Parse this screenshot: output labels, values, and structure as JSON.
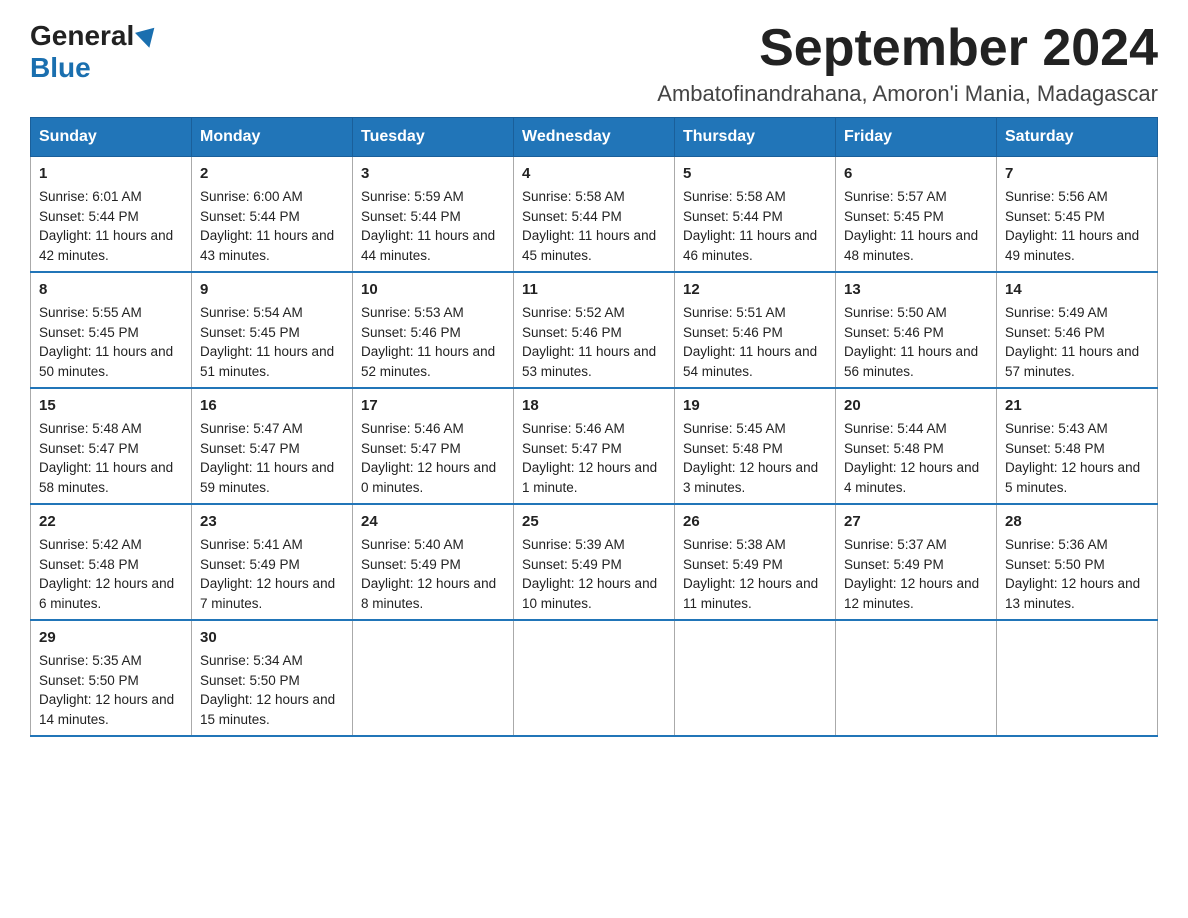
{
  "logo": {
    "general": "General",
    "blue": "Blue"
  },
  "title": "September 2024",
  "location": "Ambatofinandrahana, Amoron'i Mania, Madagascar",
  "weekdays": [
    "Sunday",
    "Monday",
    "Tuesday",
    "Wednesday",
    "Thursday",
    "Friday",
    "Saturday"
  ],
  "weeks": [
    [
      {
        "day": "1",
        "sunrise": "6:01 AM",
        "sunset": "5:44 PM",
        "daylight": "11 hours and 42 minutes."
      },
      {
        "day": "2",
        "sunrise": "6:00 AM",
        "sunset": "5:44 PM",
        "daylight": "11 hours and 43 minutes."
      },
      {
        "day": "3",
        "sunrise": "5:59 AM",
        "sunset": "5:44 PM",
        "daylight": "11 hours and 44 minutes."
      },
      {
        "day": "4",
        "sunrise": "5:58 AM",
        "sunset": "5:44 PM",
        "daylight": "11 hours and 45 minutes."
      },
      {
        "day": "5",
        "sunrise": "5:58 AM",
        "sunset": "5:44 PM",
        "daylight": "11 hours and 46 minutes."
      },
      {
        "day": "6",
        "sunrise": "5:57 AM",
        "sunset": "5:45 PM",
        "daylight": "11 hours and 48 minutes."
      },
      {
        "day": "7",
        "sunrise": "5:56 AM",
        "sunset": "5:45 PM",
        "daylight": "11 hours and 49 minutes."
      }
    ],
    [
      {
        "day": "8",
        "sunrise": "5:55 AM",
        "sunset": "5:45 PM",
        "daylight": "11 hours and 50 minutes."
      },
      {
        "day": "9",
        "sunrise": "5:54 AM",
        "sunset": "5:45 PM",
        "daylight": "11 hours and 51 minutes."
      },
      {
        "day": "10",
        "sunrise": "5:53 AM",
        "sunset": "5:46 PM",
        "daylight": "11 hours and 52 minutes."
      },
      {
        "day": "11",
        "sunrise": "5:52 AM",
        "sunset": "5:46 PM",
        "daylight": "11 hours and 53 minutes."
      },
      {
        "day": "12",
        "sunrise": "5:51 AM",
        "sunset": "5:46 PM",
        "daylight": "11 hours and 54 minutes."
      },
      {
        "day": "13",
        "sunrise": "5:50 AM",
        "sunset": "5:46 PM",
        "daylight": "11 hours and 56 minutes."
      },
      {
        "day": "14",
        "sunrise": "5:49 AM",
        "sunset": "5:46 PM",
        "daylight": "11 hours and 57 minutes."
      }
    ],
    [
      {
        "day": "15",
        "sunrise": "5:48 AM",
        "sunset": "5:47 PM",
        "daylight": "11 hours and 58 minutes."
      },
      {
        "day": "16",
        "sunrise": "5:47 AM",
        "sunset": "5:47 PM",
        "daylight": "11 hours and 59 minutes."
      },
      {
        "day": "17",
        "sunrise": "5:46 AM",
        "sunset": "5:47 PM",
        "daylight": "12 hours and 0 minutes."
      },
      {
        "day": "18",
        "sunrise": "5:46 AM",
        "sunset": "5:47 PM",
        "daylight": "12 hours and 1 minute."
      },
      {
        "day": "19",
        "sunrise": "5:45 AM",
        "sunset": "5:48 PM",
        "daylight": "12 hours and 3 minutes."
      },
      {
        "day": "20",
        "sunrise": "5:44 AM",
        "sunset": "5:48 PM",
        "daylight": "12 hours and 4 minutes."
      },
      {
        "day": "21",
        "sunrise": "5:43 AM",
        "sunset": "5:48 PM",
        "daylight": "12 hours and 5 minutes."
      }
    ],
    [
      {
        "day": "22",
        "sunrise": "5:42 AM",
        "sunset": "5:48 PM",
        "daylight": "12 hours and 6 minutes."
      },
      {
        "day": "23",
        "sunrise": "5:41 AM",
        "sunset": "5:49 PM",
        "daylight": "12 hours and 7 minutes."
      },
      {
        "day": "24",
        "sunrise": "5:40 AM",
        "sunset": "5:49 PM",
        "daylight": "12 hours and 8 minutes."
      },
      {
        "day": "25",
        "sunrise": "5:39 AM",
        "sunset": "5:49 PM",
        "daylight": "12 hours and 10 minutes."
      },
      {
        "day": "26",
        "sunrise": "5:38 AM",
        "sunset": "5:49 PM",
        "daylight": "12 hours and 11 minutes."
      },
      {
        "day": "27",
        "sunrise": "5:37 AM",
        "sunset": "5:49 PM",
        "daylight": "12 hours and 12 minutes."
      },
      {
        "day": "28",
        "sunrise": "5:36 AM",
        "sunset": "5:50 PM",
        "daylight": "12 hours and 13 minutes."
      }
    ],
    [
      {
        "day": "29",
        "sunrise": "5:35 AM",
        "sunset": "5:50 PM",
        "daylight": "12 hours and 14 minutes."
      },
      {
        "day": "30",
        "sunrise": "5:34 AM",
        "sunset": "5:50 PM",
        "daylight": "12 hours and 15 minutes."
      },
      null,
      null,
      null,
      null,
      null
    ]
  ],
  "labels": {
    "sunrise": "Sunrise:",
    "sunset": "Sunset:",
    "daylight": "Daylight:"
  }
}
